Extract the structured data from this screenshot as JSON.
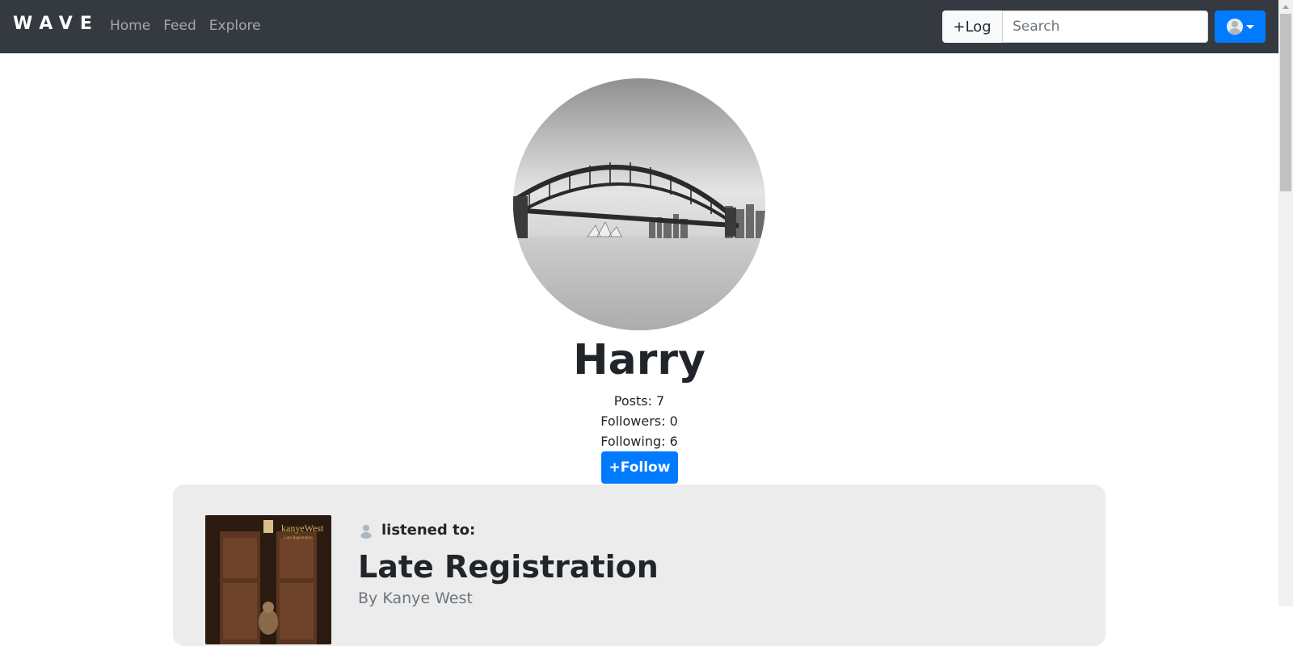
{
  "navbar": {
    "brand": "WAVE",
    "links": [
      "Home",
      "Feed",
      "Explore"
    ],
    "log_label": "+Log",
    "search_placeholder": "Search"
  },
  "profile": {
    "name": "Harry",
    "posts": "Posts: 7",
    "followers": "Followers: 0",
    "following": "Following: 6",
    "follow_label": "+Follow"
  },
  "post": {
    "action": "listened to:",
    "album": "Late Registration",
    "artist": "By Kanye West",
    "cover_text": "kanyeWest",
    "cover_subtext": "Late Registration"
  },
  "colors": {
    "navbar": "#343a40",
    "primary": "#007bff",
    "card": "#ececec"
  }
}
